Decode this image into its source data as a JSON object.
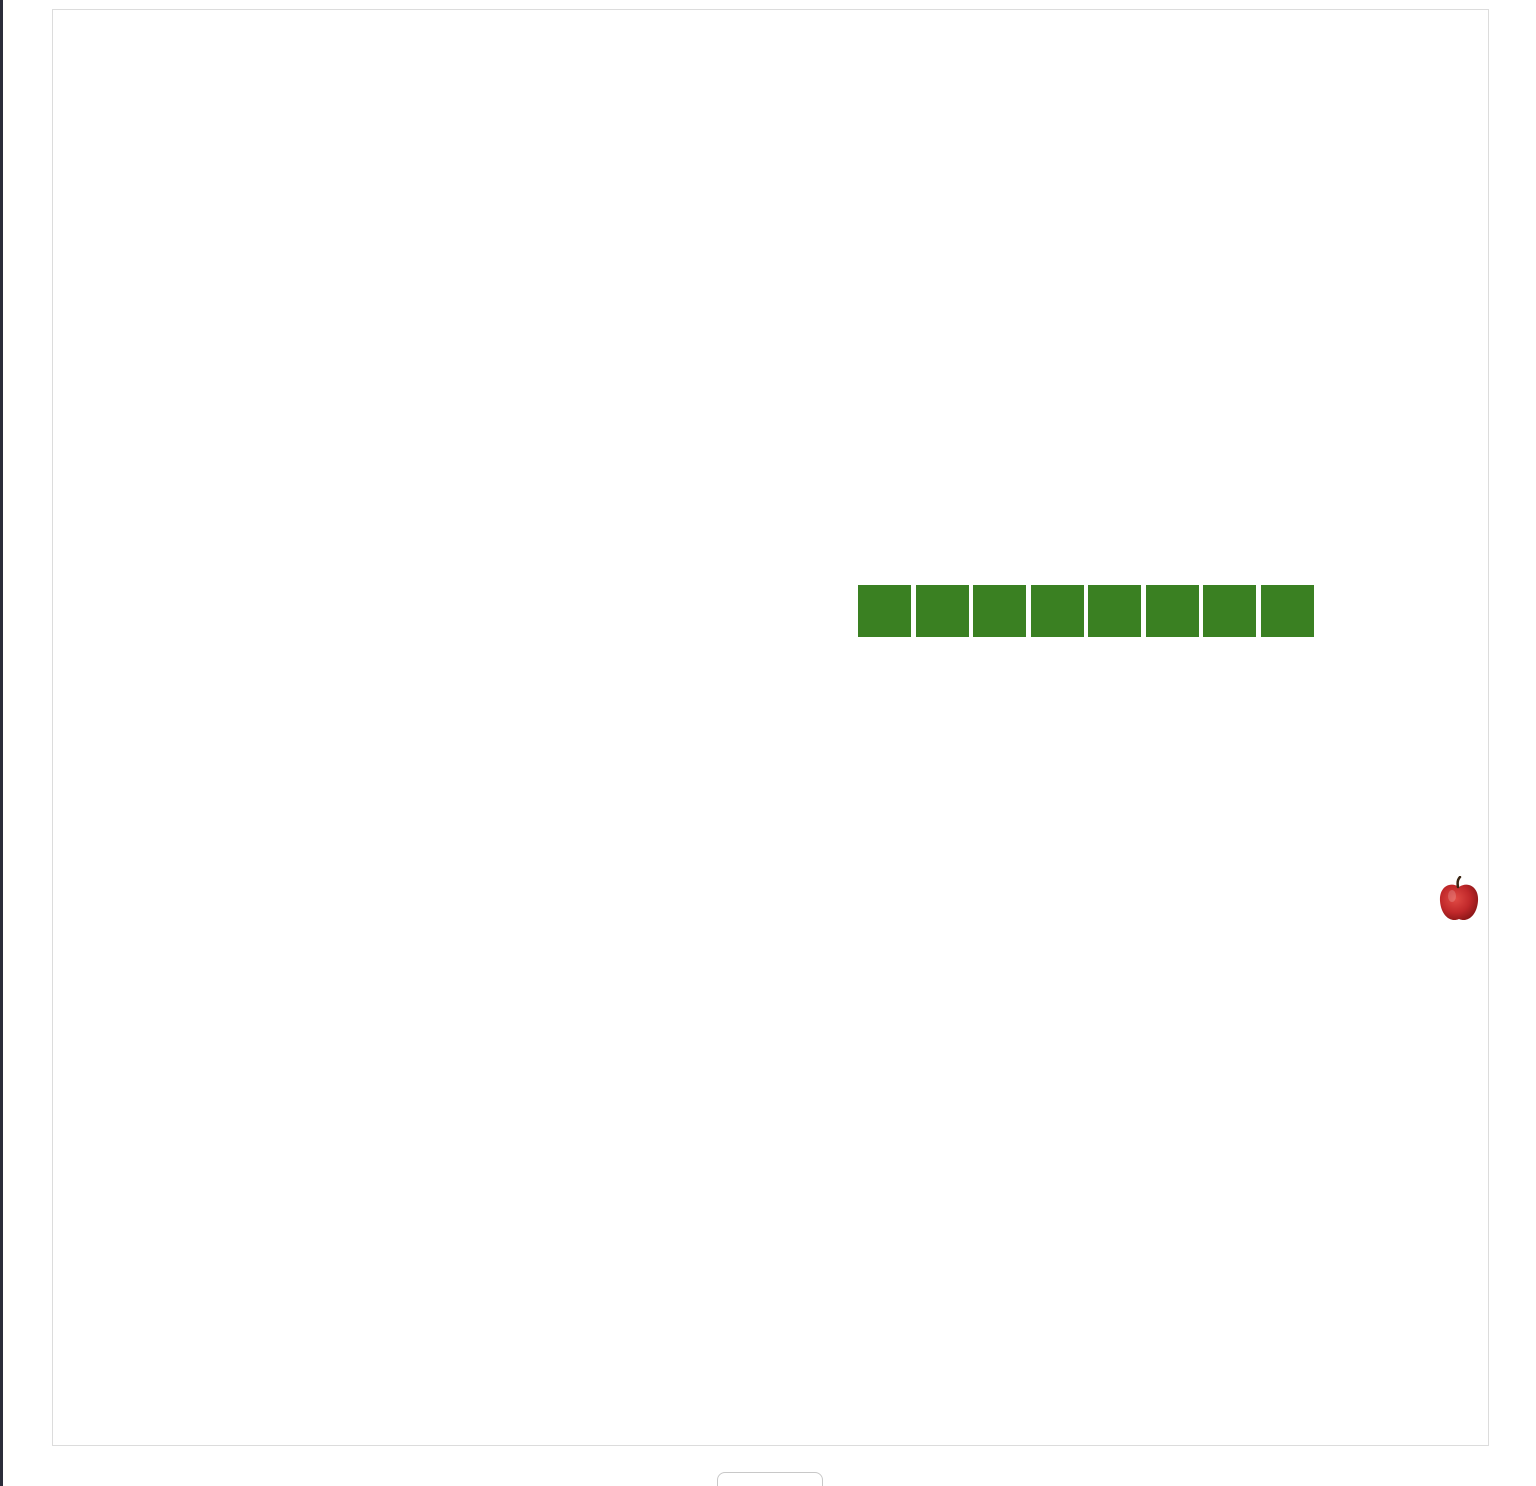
{
  "game": {
    "name": "Snake",
    "snake": {
      "color": "#3a8022",
      "border_color": "#ffffff",
      "segments": 8,
      "direction": "horizontal"
    },
    "food": {
      "type": "apple",
      "icon": "apple-icon",
      "color": "#c0282a"
    },
    "board": {
      "background": "#ffffff",
      "border_color": "#dcdcdc"
    }
  },
  "controls": {
    "button_label": ""
  }
}
